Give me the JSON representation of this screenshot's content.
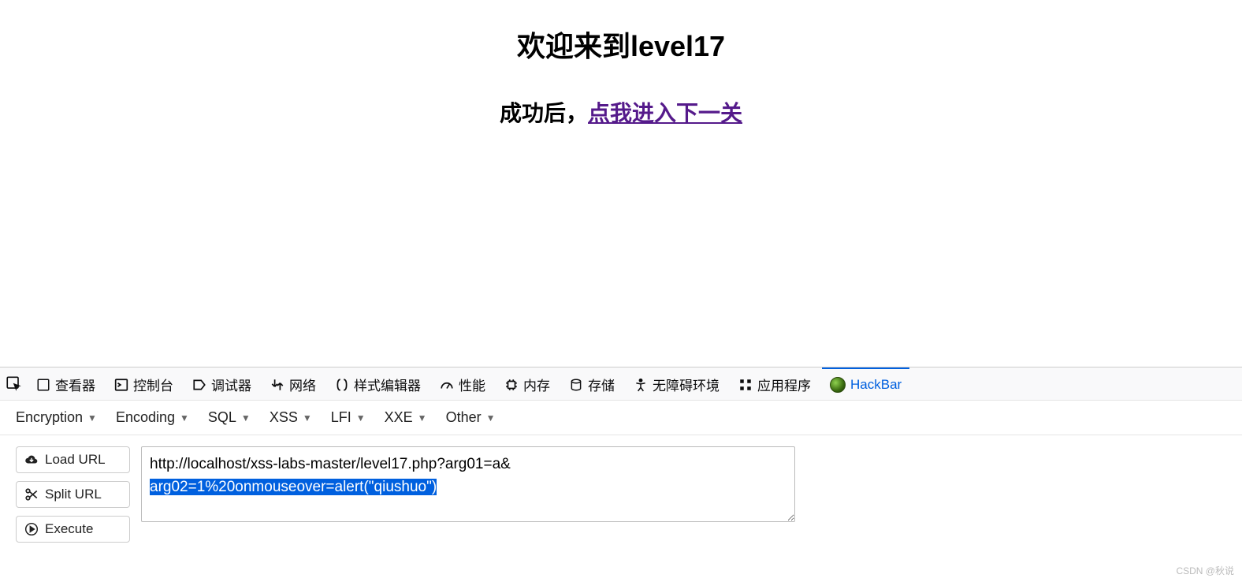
{
  "page": {
    "title": "欢迎来到level17",
    "subtitle_prefix": "成功后，",
    "subtitle_link": "点我进入下一关"
  },
  "devtools": {
    "tabs": [
      {
        "id": "inspector",
        "label": "查看器"
      },
      {
        "id": "console",
        "label": "控制台"
      },
      {
        "id": "debugger",
        "label": "调试器"
      },
      {
        "id": "network",
        "label": "网络"
      },
      {
        "id": "style",
        "label": "样式编辑器"
      },
      {
        "id": "performance",
        "label": "性能"
      },
      {
        "id": "memory",
        "label": "内存"
      },
      {
        "id": "storage",
        "label": "存储"
      },
      {
        "id": "accessibility",
        "label": "无障碍环境"
      },
      {
        "id": "application",
        "label": "应用程序"
      },
      {
        "id": "hackbar",
        "label": "HackBar",
        "active": true
      }
    ]
  },
  "hackbar": {
    "menus": [
      {
        "label": "Encryption"
      },
      {
        "label": "Encoding"
      },
      {
        "label": "SQL"
      },
      {
        "label": "XSS"
      },
      {
        "label": "LFI"
      },
      {
        "label": "XXE"
      },
      {
        "label": "Other"
      }
    ],
    "buttons": {
      "load_url": "Load URL",
      "split_url": "Split URL",
      "execute": "Execute"
    },
    "url_line1": "http://localhost/xss-labs-master/level17.php?arg01=a&",
    "url_line2_selected": "arg02=1%20onmouseover=alert(\"qiushuo\")"
  },
  "watermark": "CSDN @秋说"
}
